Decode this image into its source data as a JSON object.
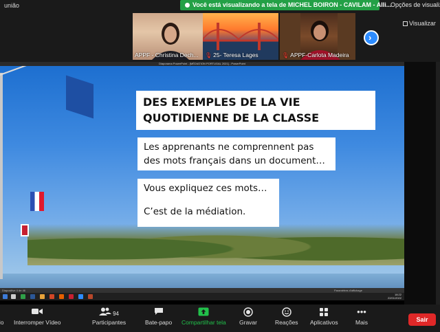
{
  "window": {
    "meeting_title": "união"
  },
  "share_banner": {
    "text": "Você está visualizando a tela de MICHEL BOIRON - CAVILAM - Alli..."
  },
  "view_options": {
    "label": "Opções de visualiz"
  },
  "gallery": {
    "visualizar_label": "Visualizar",
    "participants": [
      {
        "name": "APPF - Christina Dech...",
        "muted": false
      },
      {
        "name": "25- Teresa Lages",
        "muted": true
      },
      {
        "name": "APPF-Carlota Madeira",
        "muted": true
      }
    ]
  },
  "presentation": {
    "window_title": "Diaporama PowerPoint - [MÉDIATION PORTUGAL 2021] - PowerPoint",
    "slide": {
      "title": "DES EXEMPLES DE LA VIE QUOTIDIENNE DE LA CLASSE",
      "box1": "Les apprenants ne comprennent pas des mots français dans un document…",
      "box2_line1": "Vous expliquez ces mots…",
      "box2_line2": "C’est de la médiation."
    },
    "status_left": "Diapositive 4 de 46",
    "status_right": "Paramètres d'affichage",
    "clock_time": "18:22",
    "clock_date": "22/01/2022"
  },
  "toolbar": {
    "video_label": "Interromper Vídeo",
    "participants_label": "Participantes",
    "participants_count": "94",
    "chat_label": "Bate-papo",
    "share_label": "Compartilhar tela",
    "record_label": "Gravar",
    "reactions_label": "Reações",
    "apps_label": "Aplicativos",
    "more_label": "Mais",
    "leave_label": "Sair",
    "audio_label": "do"
  },
  "colors": {
    "share_green": "#23a046",
    "accent_blue": "#2d8cff",
    "leave_red": "#e02828",
    "toolbar_bg": "#1a1a1a"
  }
}
